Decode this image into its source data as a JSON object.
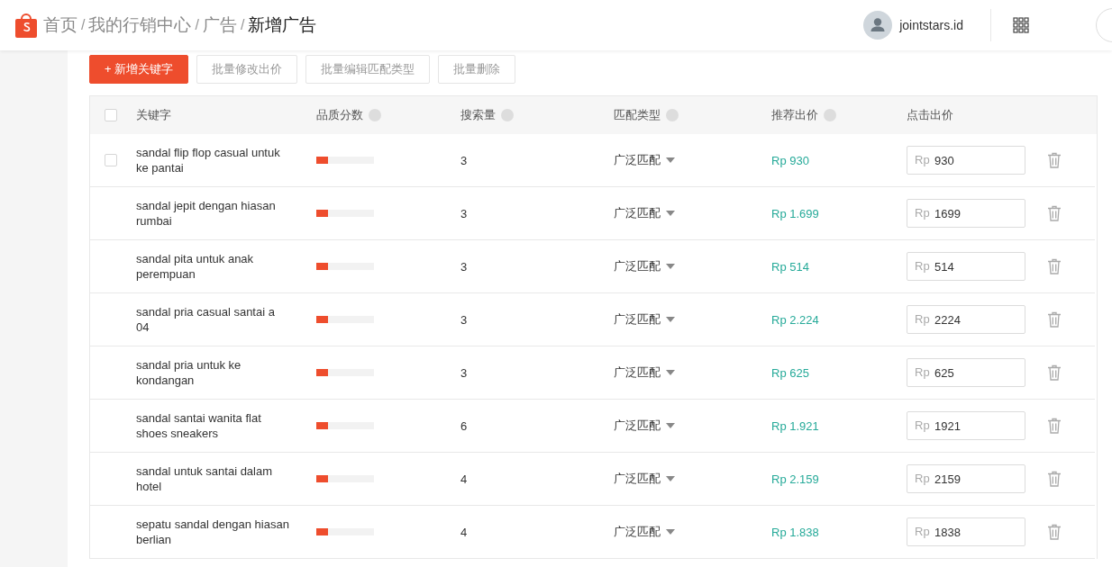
{
  "breadcrumb": [
    {
      "label": "首页",
      "current": false
    },
    {
      "label": "我的行销中心",
      "current": false
    },
    {
      "label": "广告",
      "current": false
    },
    {
      "label": "新增广告",
      "current": true
    }
  ],
  "breadcrumb_separator": "/",
  "account": {
    "username": "jointstars.id"
  },
  "toolbar": [
    {
      "label": "+ 新增关键字",
      "kind": "primary"
    },
    {
      "label": "批量修改出价",
      "kind": "default"
    },
    {
      "label": "批量编辑匹配类型",
      "kind": "default"
    },
    {
      "label": "批量删除",
      "kind": "default"
    }
  ],
  "table": {
    "header_checkbox": {
      "checked": false
    },
    "columns": [
      {
        "label": "关键字"
      },
      {
        "label": "品质分数",
        "help": true
      },
      {
        "label": "搜索量",
        "help": true
      },
      {
        "label": "匹配类型",
        "help": true
      },
      {
        "label": "推荐出价",
        "help": true
      },
      {
        "label": "点击出价"
      }
    ],
    "rows": [
      {
        "keyword": "sandal flip flop casual untuk ke pantai",
        "checkbox": {
          "checked": false
        },
        "quality": {
          "level": 0.2
        },
        "search_volume": "3",
        "match_type": "广泛匹配",
        "recommended_bid": "Rp 930",
        "bid": {
          "prefix": "Rp",
          "value": "930"
        }
      },
      {
        "keyword": "sandal jepit dengan hiasan rumbai",
        "quality": {
          "level": 0.2
        },
        "search_volume": "3",
        "match_type": "广泛匹配",
        "recommended_bid": "Rp 1.699",
        "bid": {
          "prefix": "Rp",
          "value": "1699"
        }
      },
      {
        "keyword": "sandal pita untuk anak perempuan",
        "quality": {
          "level": 0.2
        },
        "search_volume": "3",
        "match_type": "广泛匹配",
        "recommended_bid": "Rp 514",
        "bid": {
          "prefix": "Rp",
          "value": "514"
        }
      },
      {
        "keyword": "sandal pria casual santai a 04",
        "quality": {
          "level": 0.2
        },
        "search_volume": "3",
        "match_type": "广泛匹配",
        "recommended_bid": "Rp 2.224",
        "bid": {
          "prefix": "Rp",
          "value": "2224"
        }
      },
      {
        "keyword": "sandal pria untuk ke kondangan",
        "quality": {
          "level": 0.2
        },
        "search_volume": "3",
        "match_type": "广泛匹配",
        "recommended_bid": "Rp 625",
        "bid": {
          "prefix": "Rp",
          "value": "625"
        }
      },
      {
        "keyword": "sandal santai wanita flat shoes sneakers",
        "quality": {
          "level": 0.2
        },
        "search_volume": "6",
        "match_type": "广泛匹配",
        "recommended_bid": "Rp 1.921",
        "bid": {
          "prefix": "Rp",
          "value": "1921"
        }
      },
      {
        "keyword": "sandal untuk santai dalam hotel",
        "quality": {
          "level": 0.2
        },
        "search_volume": "4",
        "match_type": "广泛匹配",
        "recommended_bid": "Rp 2.159",
        "bid": {
          "prefix": "Rp",
          "value": "2159"
        }
      },
      {
        "keyword": "sepatu sandal dengan hiasan berlian",
        "quality": {
          "level": 0.2
        },
        "search_volume": "4",
        "match_type": "广泛匹配",
        "recommended_bid": "Rp 1.838",
        "bid": {
          "prefix": "Rp",
          "value": "1838"
        }
      }
    ]
  }
}
